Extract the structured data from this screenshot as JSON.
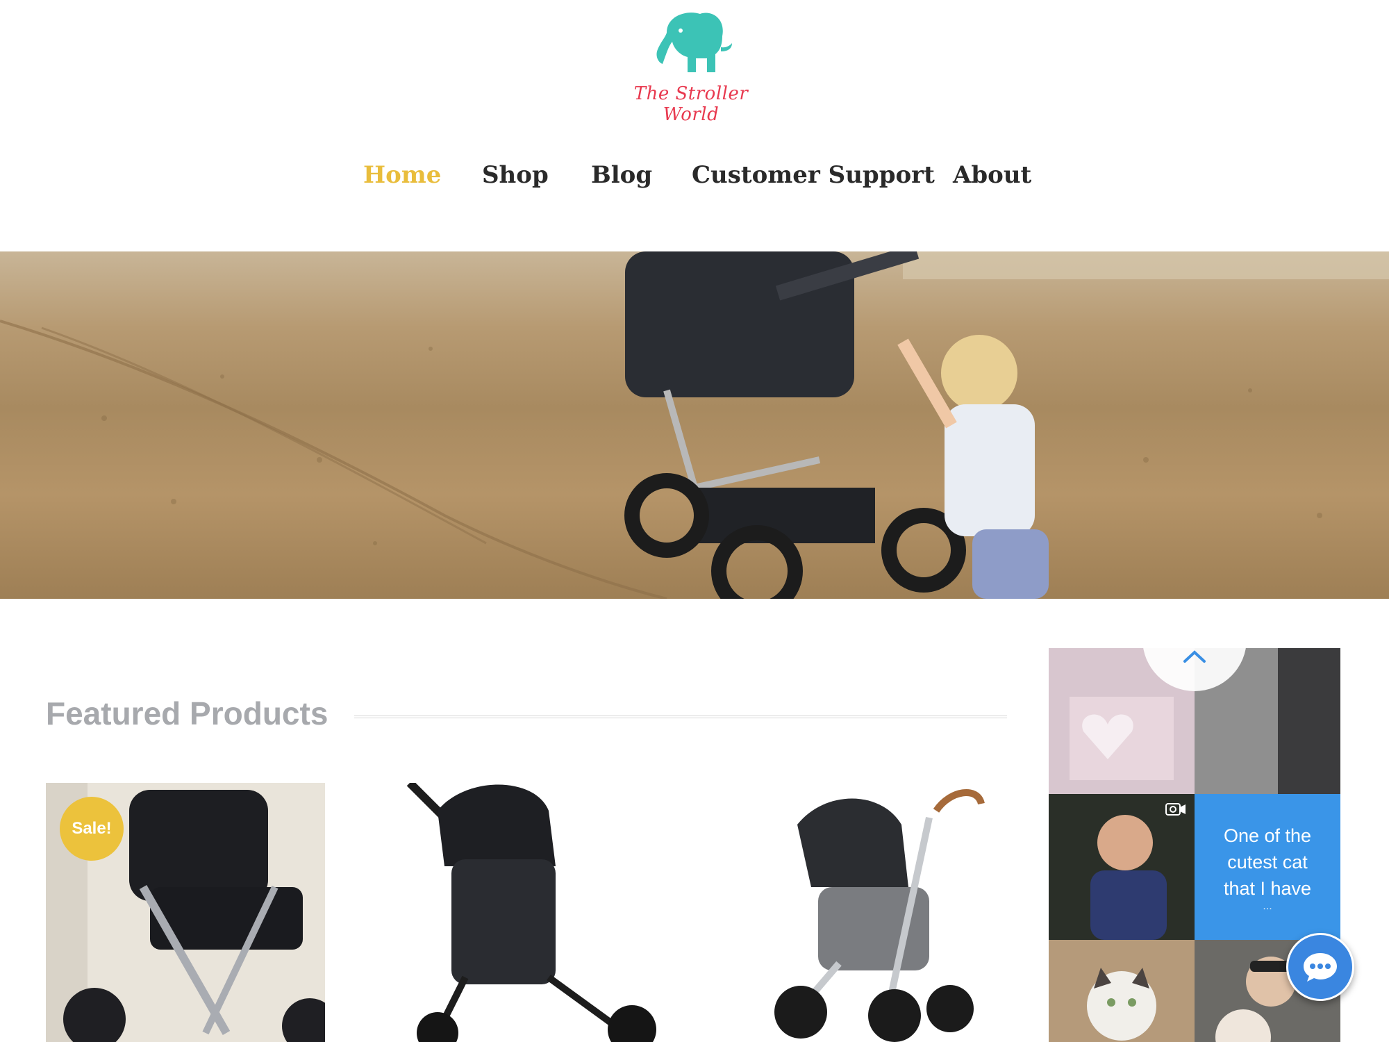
{
  "header": {
    "logo_text": "The Stroller World",
    "logo_icon": "elephant-icon",
    "brand_colors": {
      "icon": "#3cc3b6",
      "text": "#e8394f"
    }
  },
  "nav": {
    "items": [
      {
        "label": "Home",
        "active": true
      },
      {
        "label": "Shop",
        "active": false
      },
      {
        "label": "Blog",
        "active": false
      },
      {
        "label": "Customer Support",
        "active": false
      },
      {
        "label": "About",
        "active": false
      }
    ],
    "active_color": "#e9bd3c"
  },
  "featured": {
    "title": "Featured Products",
    "products": [
      {
        "badge": "Sale!"
      },
      {},
      {}
    ]
  },
  "social_widget": {
    "caption": [
      "One of the",
      "cutest cat",
      "that I have"
    ],
    "caption_more": "...",
    "scroll_up_icon": "chevron-up-icon",
    "video_icon": "video-camera-icon",
    "accent": "#3a95e8"
  },
  "chat": {
    "icon": "chat-bubble-icon",
    "color": "#3a86e0"
  }
}
